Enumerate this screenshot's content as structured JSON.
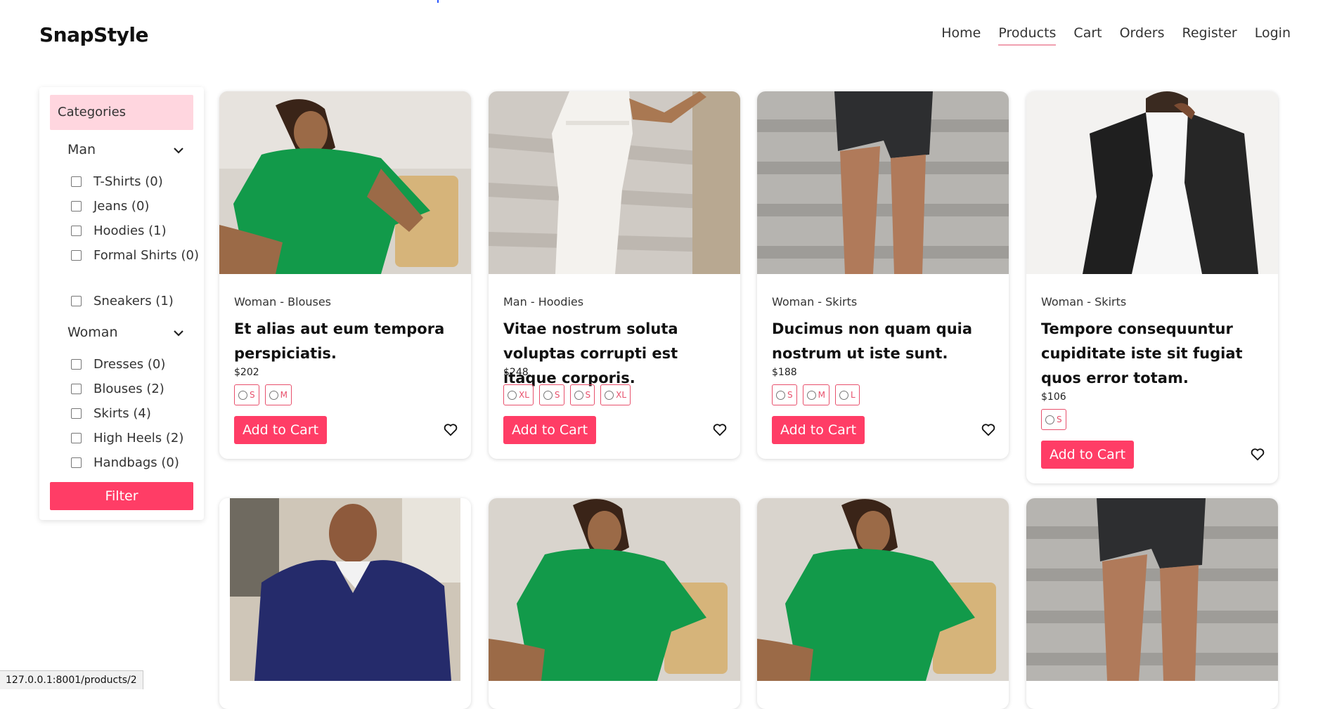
{
  "brand": "SnapStyle",
  "nav": [
    "Home",
    "Products",
    "Cart",
    "Orders",
    "Register",
    "Login"
  ],
  "sidebar": {
    "heading": "Categories",
    "groups": [
      {
        "title": "Man",
        "items": [
          "T-Shirts (0)",
          "Jeans (0)",
          "Hoodies (1)",
          "Formal Shirts (0)",
          "Sneakers (1)"
        ]
      },
      {
        "title": "Woman",
        "items": [
          "Dresses (0)",
          "Blouses (2)",
          "Skirts (4)",
          "High Heels (2)",
          "Handbags (0)"
        ]
      }
    ],
    "filter_label": "Filter"
  },
  "products": [
    {
      "category": "Woman - Blouses",
      "title": "Et alias aut eum tempora perspiciatis.",
      "price": "$202",
      "sizes": [
        "S",
        "M"
      ],
      "add_label": "Add to Cart",
      "image": "green-dress"
    },
    {
      "category": "Man - Hoodies",
      "title": "Vitae nostrum soluta voluptas corrupti est itaque corporis.",
      "price": "$248",
      "sizes": [
        "XL",
        "S",
        "S",
        "XL"
      ],
      "add_label": "Add to Cart",
      "image": "white-gown"
    },
    {
      "category": "Woman - Skirts",
      "title": "Ducimus non quam quia nostrum ut iste sunt.",
      "price": "$188",
      "sizes": [
        "S",
        "M",
        "L"
      ],
      "add_label": "Add to Cart",
      "image": "cargo-shorts"
    },
    {
      "category": "Woman - Skirts",
      "title": "Tempore consequuntur cupiditate iste sit fugiat quos error totam.",
      "price": "$106",
      "sizes": [
        "S"
      ],
      "add_label": "Add to Cart",
      "image": "leather-jacket"
    }
  ],
  "second_row_images": [
    "navy-sweater",
    "green-dress",
    "green-dress",
    "cargo-shorts"
  ],
  "status_url": "127.0.0.1:8001/products/2"
}
